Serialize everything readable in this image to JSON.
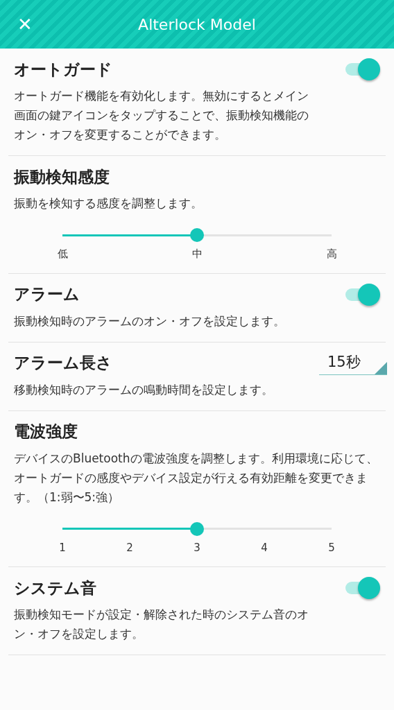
{
  "header": {
    "close_glyph": "✕",
    "title": "Alterlock Model"
  },
  "settings": [
    {
      "kind": "toggle",
      "title": "オートガード",
      "description": "オートガード機能を有効化します。無効にするとメイン画面の鍵アイコンをタップすることで、振動検知機能のオン・オフを変更することができます。",
      "on": true
    },
    {
      "kind": "slider",
      "title": "振動検知感度",
      "description": "振動を検知する感度を調整します。",
      "level": 0.5,
      "ticks": [
        "低",
        "中",
        "高"
      ]
    },
    {
      "kind": "toggle",
      "title": "アラーム",
      "description": "振動検知時のアラームのオン・オフを設定します。",
      "on": true
    },
    {
      "kind": "select",
      "title": "アラーム長さ",
      "description": "移動検知時のアラームの鳴動時間を設定します。",
      "value": "15秒"
    },
    {
      "kind": "slider",
      "title": "電波強度",
      "description": "デバイスのBluetoothの電波強度を調整します。利用環境に応じて、オートガードの感度やデバイス設定が行える有効距離を変更できます。（1:弱〜5:強）",
      "level": 0.5,
      "ticks": [
        "1",
        "2",
        "3",
        "4",
        "5"
      ]
    },
    {
      "kind": "toggle",
      "title": "システム音",
      "description": "振動検知モードが設定・解除された時のシステム音のオン・オフを設定します。",
      "on": true
    }
  ]
}
